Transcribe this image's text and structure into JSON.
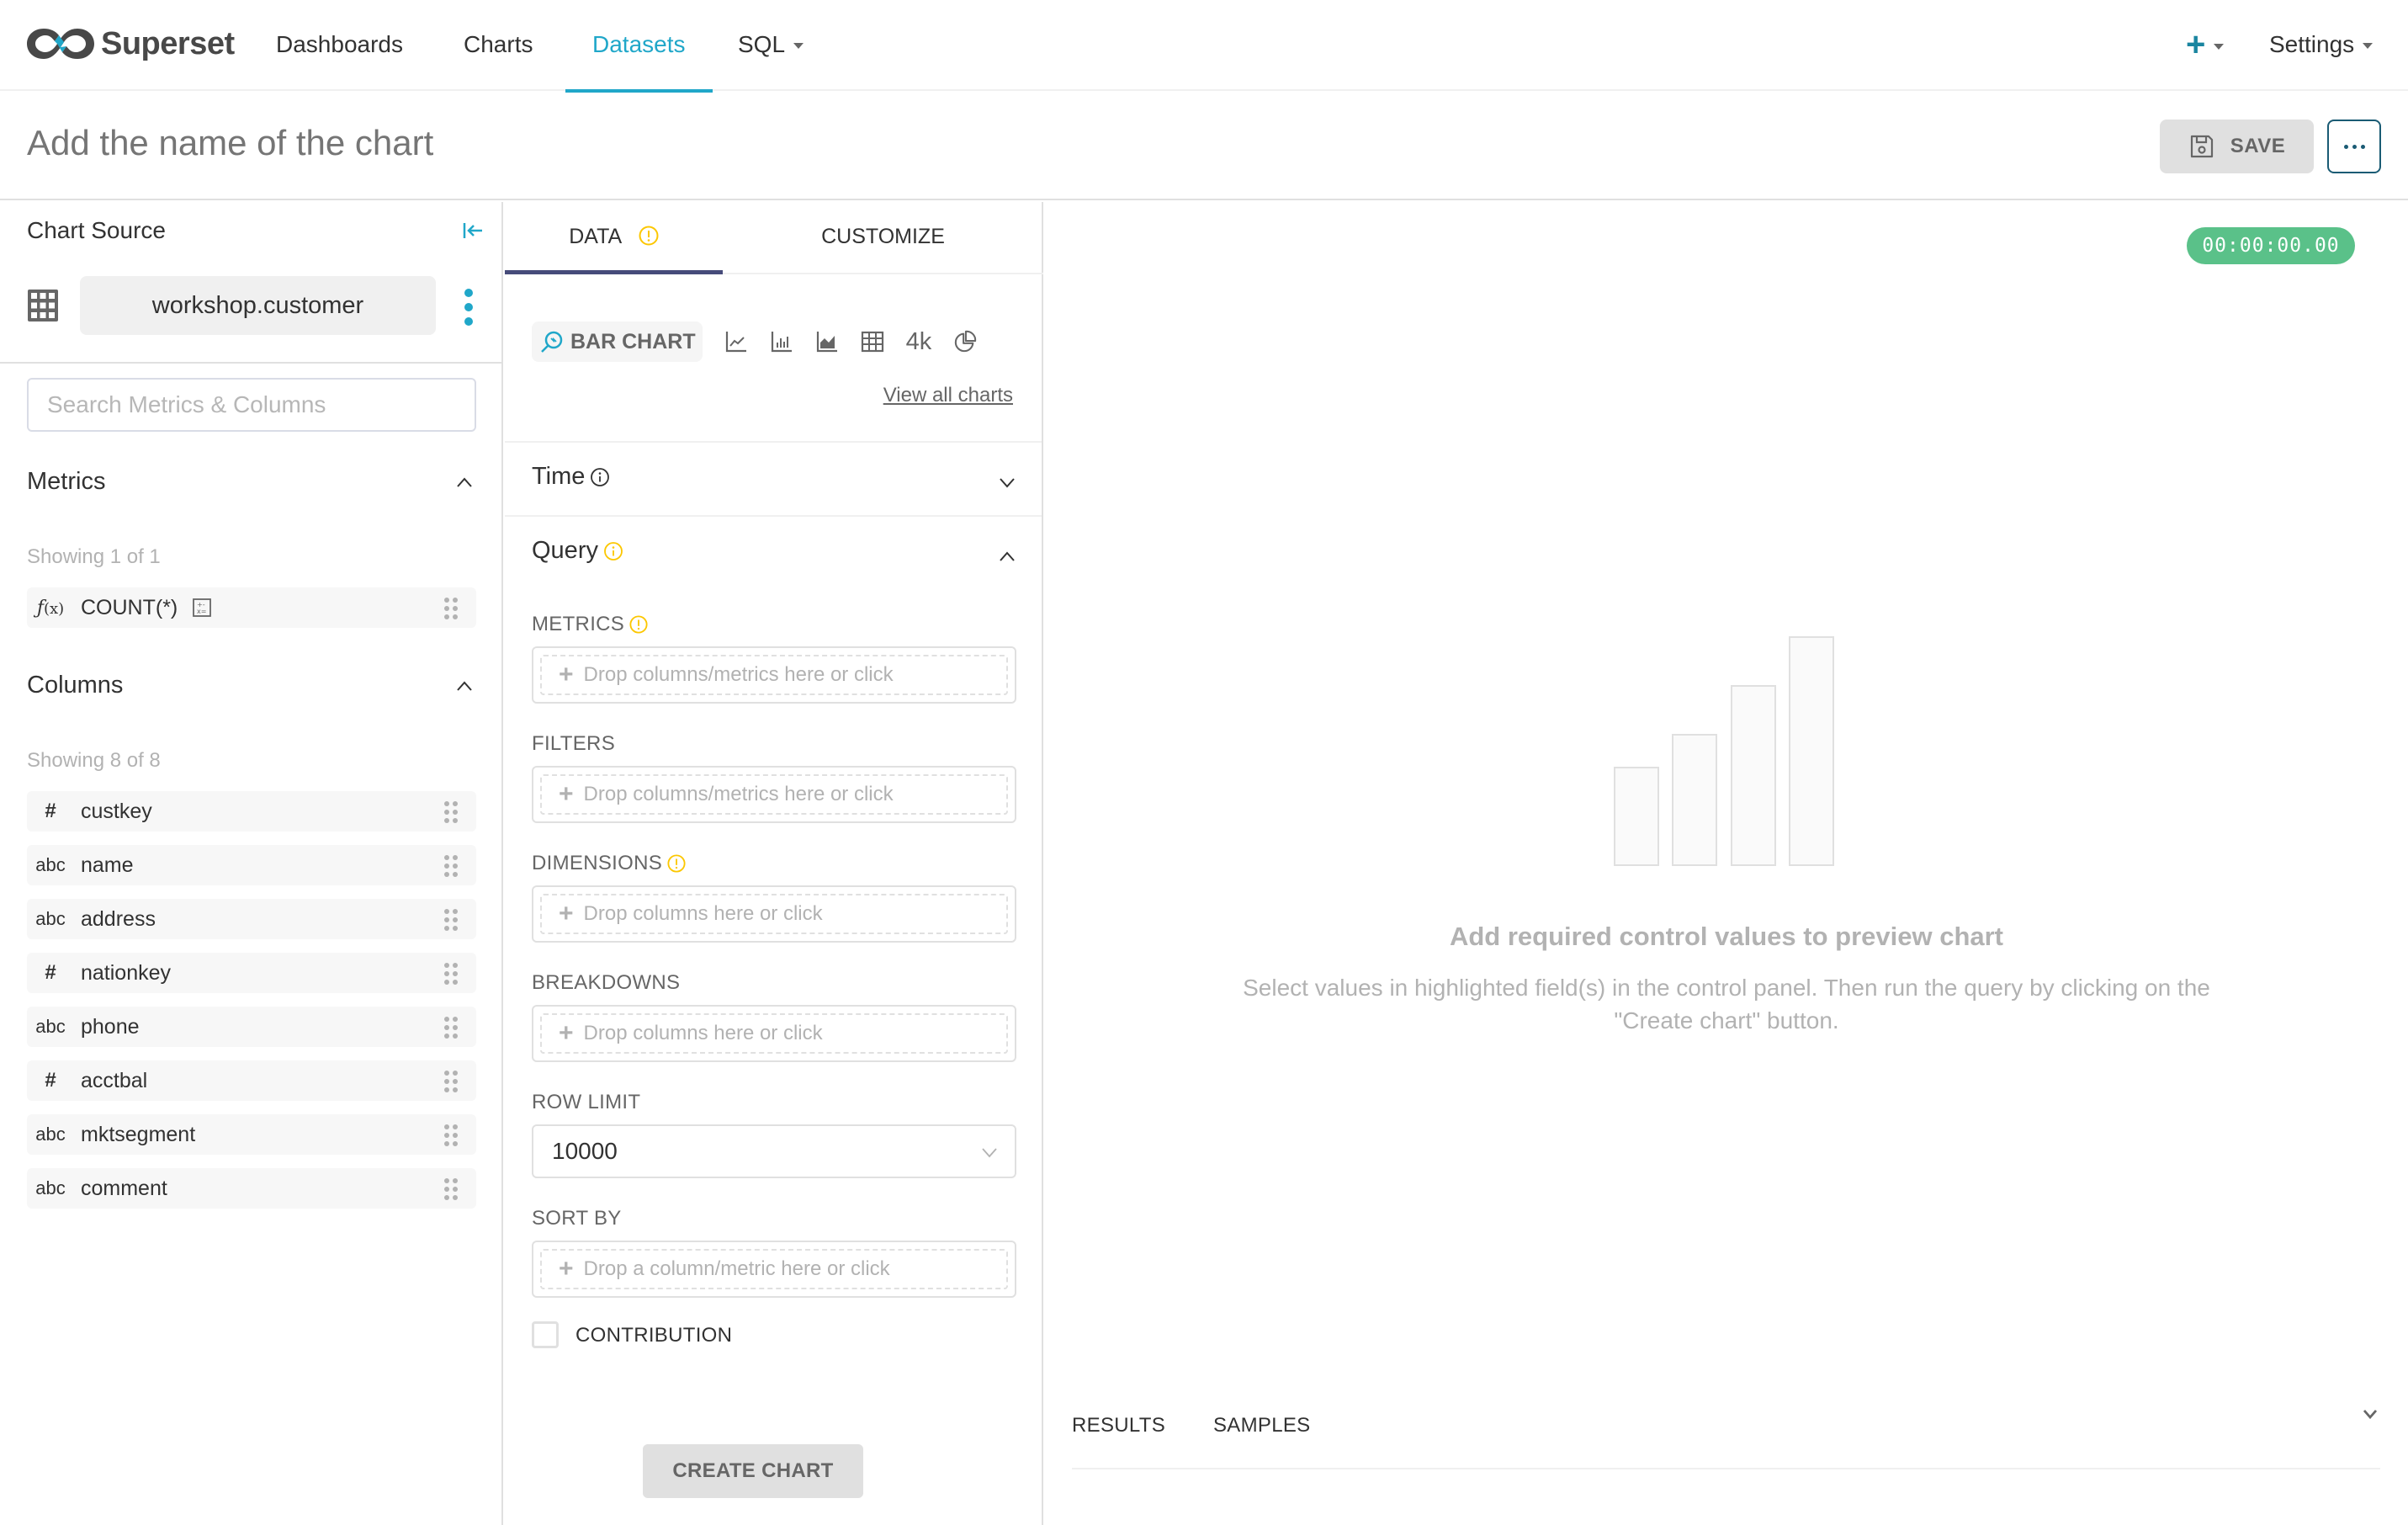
{
  "navbar": {
    "brand": "Superset",
    "items": [
      {
        "label": "Dashboards",
        "active": false
      },
      {
        "label": "Charts",
        "active": false
      },
      {
        "label": "Datasets",
        "active": true
      },
      {
        "label": "SQL",
        "active": false,
        "dropdown": true
      }
    ],
    "new_icon": "plus-icon",
    "settings_label": "Settings",
    "accent_color": "#20a7c9"
  },
  "header": {
    "chart_name_placeholder": "Add the name of the chart",
    "chart_name_value": "",
    "save_label": "SAVE",
    "save_icon": "floppy-disk-icon",
    "more_icon": "ellipsis-icon"
  },
  "left_panel": {
    "title": "Chart Source",
    "collapse_icon": "collapse-left-icon",
    "dataset": {
      "icon": "table-grid-icon",
      "name": "workshop.customer",
      "menu_icon": "vertical-ellipsis-icon"
    },
    "search_placeholder": "Search Metrics & Columns",
    "search_value": "",
    "metrics": {
      "title": "Metrics",
      "showing": "Showing 1 of 1",
      "items": [
        {
          "type_label": "f(x)",
          "label": "COUNT(*)",
          "has_calc_icon": true
        }
      ]
    },
    "columns": {
      "title": "Columns",
      "showing": "Showing 8 of 8",
      "items": [
        {
          "type_label": "#",
          "label": "custkey"
        },
        {
          "type_label": "abc",
          "label": "name"
        },
        {
          "type_label": "abc",
          "label": "address"
        },
        {
          "type_label": "#",
          "label": "nationkey"
        },
        {
          "type_label": "abc",
          "label": "phone"
        },
        {
          "type_label": "#",
          "label": "acctbal"
        },
        {
          "type_label": "abc",
          "label": "mktsegment"
        },
        {
          "type_label": "abc",
          "label": "comment"
        }
      ]
    }
  },
  "control_panel": {
    "tabs": [
      {
        "label": "DATA",
        "active": true,
        "warning": true
      },
      {
        "label": "CUSTOMIZE",
        "active": false
      }
    ],
    "chart_type": {
      "selected": "BAR CHART",
      "quick_types": [
        "line-chart-icon",
        "bar-chart-icon",
        "area-chart-icon",
        "table-icon",
        "big-number-icon",
        "pie-chart-icon"
      ],
      "big_number_label": "4k",
      "view_all": "View all charts"
    },
    "sections": {
      "time": {
        "title": "Time",
        "expanded": false
      },
      "query": {
        "title": "Query",
        "expanded": true
      }
    },
    "controls": {
      "metrics": {
        "label": "METRICS",
        "placeholder": "Drop columns/metrics here or click",
        "warning": true
      },
      "filters": {
        "label": "FILTERS",
        "placeholder": "Drop columns/metrics here or click"
      },
      "dimensions": {
        "label": "DIMENSIONS",
        "placeholder": "Drop columns here or click",
        "warning": true
      },
      "breakdowns": {
        "label": "BREAKDOWNS",
        "placeholder": "Drop columns here or click"
      },
      "row_limit": {
        "label": "ROW LIMIT",
        "value": "10000"
      },
      "sort_by": {
        "label": "SORT BY",
        "placeholder": "Drop a column/metric here or click"
      },
      "contribution": {
        "label": "CONTRIBUTION",
        "checked": false
      }
    },
    "create_chart_label": "CREATE CHART",
    "warning_color": "#fcc700"
  },
  "preview": {
    "timer": "00:00:00.00",
    "timer_color": "#5ac189",
    "empty_title": "Add required control values to preview chart",
    "empty_description": "Select values in highlighted field(s) in the control panel. Then run the query by clicking on the \"Create chart\" button.",
    "results_tabs": [
      "RESULTS",
      "SAMPLES"
    ]
  }
}
